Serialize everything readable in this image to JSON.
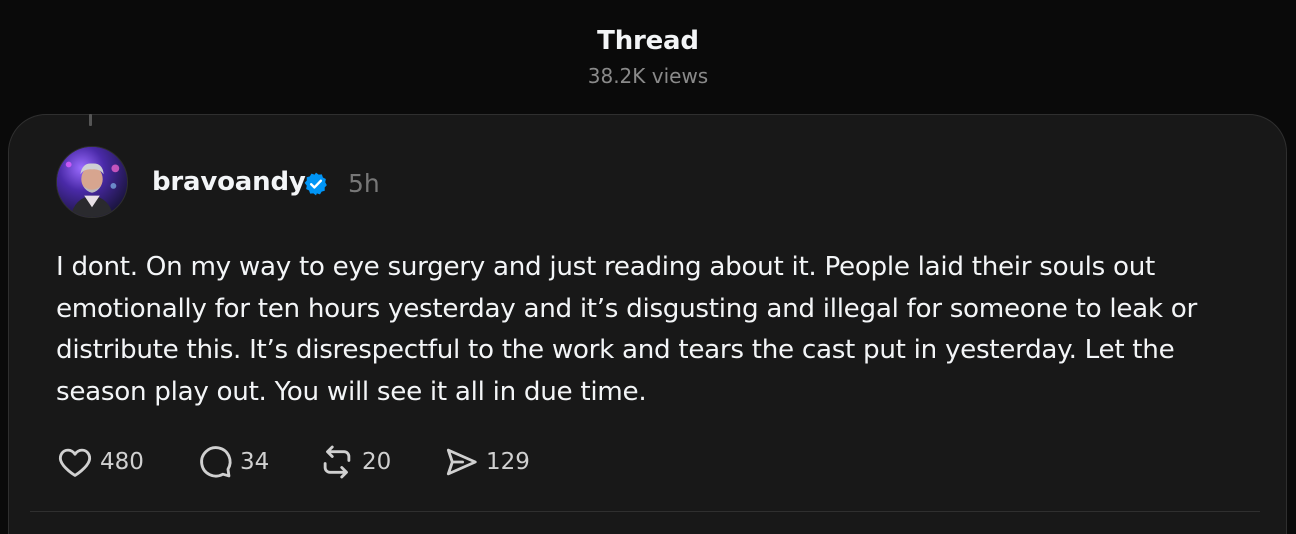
{
  "header": {
    "title": "Thread",
    "views": "38.2K views"
  },
  "post": {
    "username": "bravoandy",
    "verified": true,
    "timestamp": "5h",
    "text": "I dont. On my way to eye surgery and just reading about it. People laid their souls out emotionally for ten hours yesterday and it’s disgusting and illegal for someone to leak or distribute this. It’s disrespectful to the work and tears the cast put in yesterday. Let the season play out. You will see it all in due time.",
    "actions": {
      "likes": "480",
      "replies": "34",
      "reposts": "20",
      "shares": "129"
    }
  },
  "icons": {
    "like": "heart-icon",
    "reply": "comment-bubble-icon",
    "repost": "repost-icon",
    "share": "send-icon",
    "verified": "verified-badge-icon"
  },
  "colors": {
    "background": "#0a0a0a",
    "card": "#181818",
    "verified": "#0095f6",
    "muted": "#777777"
  }
}
